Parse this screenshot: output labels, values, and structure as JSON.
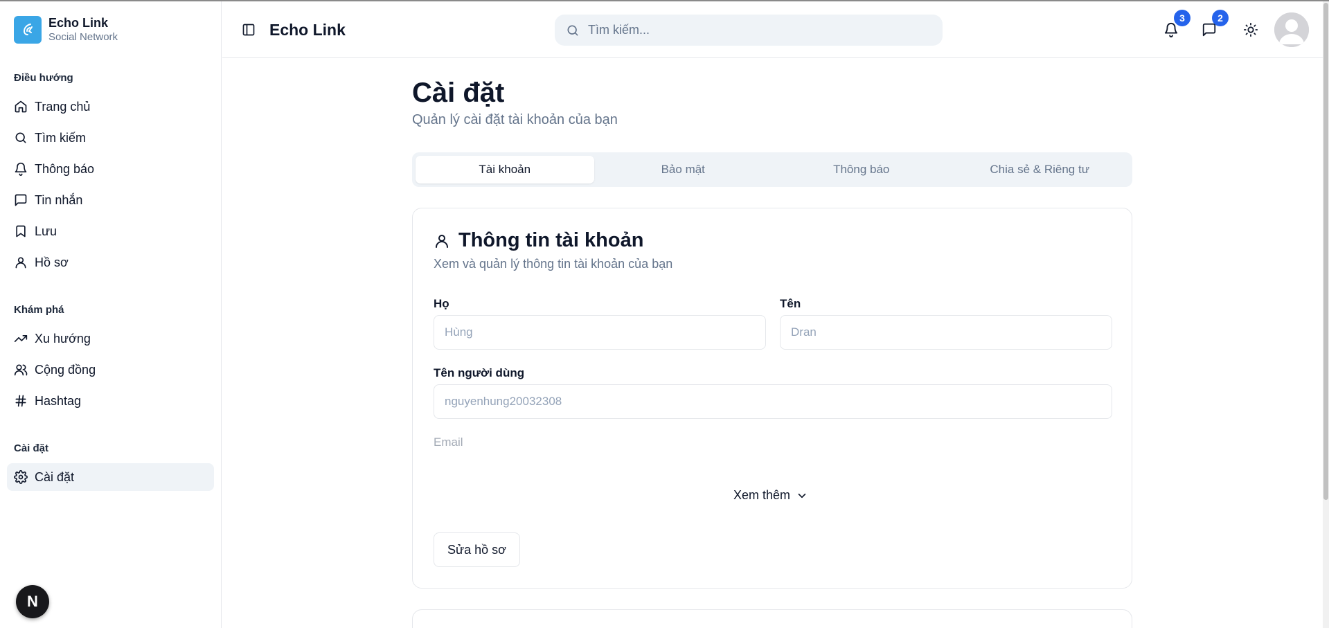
{
  "brand": {
    "title": "Echo Link",
    "subtitle": "Social Network"
  },
  "sidebar": {
    "groups": [
      {
        "label": "Điều hướng"
      },
      {
        "label": "Khám phá"
      },
      {
        "label": "Cài đặt"
      }
    ],
    "items": [
      {
        "label": "Trang chủ",
        "icon": "home-icon"
      },
      {
        "label": "Tìm kiếm",
        "icon": "search-icon"
      },
      {
        "label": "Thông báo",
        "icon": "bell-icon"
      },
      {
        "label": "Tin nhắn",
        "icon": "message-icon"
      },
      {
        "label": "Lưu",
        "icon": "bookmark-icon"
      },
      {
        "label": "Hồ sơ",
        "icon": "user-icon"
      },
      {
        "label": "Xu hướng",
        "icon": "trending-icon"
      },
      {
        "label": "Cộng đồng",
        "icon": "users-icon"
      },
      {
        "label": "Hashtag",
        "icon": "hash-icon"
      },
      {
        "label": "Cài đặt",
        "icon": "gear-icon",
        "active": true
      }
    ],
    "next_badge": "N"
  },
  "header": {
    "title": "Echo Link",
    "search_placeholder": "Tìm kiếm...",
    "notifications_count": "3",
    "messages_count": "2"
  },
  "page": {
    "title": "Cài đặt",
    "subtitle": "Quản lý cài đặt tài khoản của bạn",
    "tabs": [
      {
        "label": "Tài khoản",
        "active": true
      },
      {
        "label": "Bảo mật"
      },
      {
        "label": "Thông báo"
      },
      {
        "label": "Chia sẻ & Riêng tư"
      }
    ]
  },
  "account_card": {
    "title": "Thông tin tài khoản",
    "description": "Xem và quản lý thông tin tài khoản của bạn",
    "last_name_label": "Họ",
    "last_name_value": "Hùng",
    "first_name_label": "Tên",
    "first_name_value": "Dran",
    "username_label": "Tên người dùng",
    "username_value": "nguyenhung20032308",
    "email_label": "Email",
    "more_label": "Xem thêm",
    "edit_button": "Sửa hồ sơ"
  },
  "colors": {
    "accent": "#2563eb",
    "brand_logo": "#3aa6e6",
    "muted_text": "#64748b",
    "active_bg": "#eff3f7"
  }
}
